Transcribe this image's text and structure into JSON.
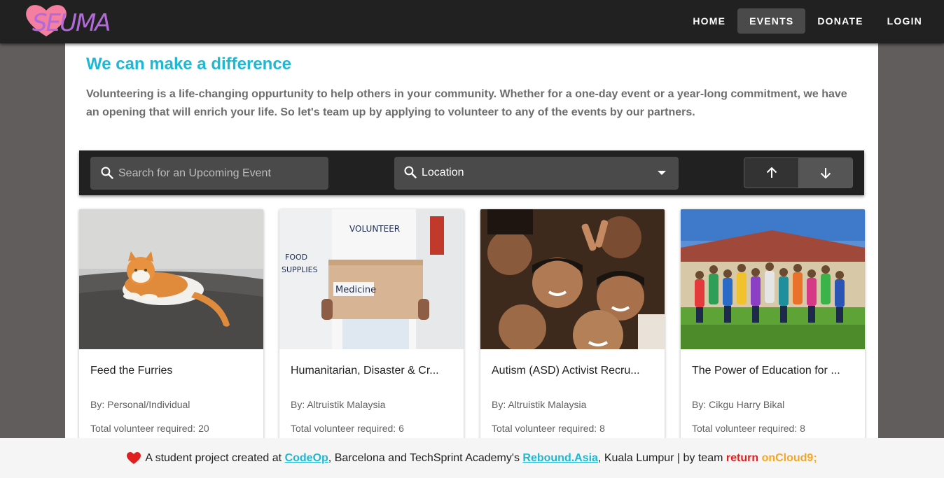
{
  "nav": {
    "logo_text": "SEUMA",
    "items": [
      {
        "label": "HOME",
        "active": false
      },
      {
        "label": "EVENTS",
        "active": true
      },
      {
        "label": "DONATE",
        "active": false
      },
      {
        "label": "LOGIN",
        "active": false
      }
    ]
  },
  "intro": {
    "title": "We can make a difference",
    "body": "Volunteering is a life-changing oppurtunity to help others in your community. Whether for a one-day event or a year-long commitment, we have an opening that will enrich your life. So let's team up by applying to volunteer to any of the events by our partners."
  },
  "filters": {
    "search_placeholder": "Search for an Upcoming Event",
    "search_value": "",
    "location_label": "Location",
    "sort_icons": [
      "arrow-up-icon",
      "arrow-down-icon"
    ],
    "active_sort": "descending"
  },
  "events": [
    {
      "title": "Feed the Furries",
      "by": "By: Personal/Individual",
      "required": "Total volunteer required: 20",
      "image": "orange-white-cat-photo"
    },
    {
      "title": "Humanitarian, Disaster & Cr...",
      "by": "By: Altruistik Malaysia",
      "required": "Total volunteer required: 6",
      "image": "volunteer-medicine-box-photo"
    },
    {
      "title": "Autism (ASD) Activist Recru...",
      "by": "By: Altruistik Malaysia",
      "required": "Total volunteer required: 8",
      "image": "smiling-children-photo"
    },
    {
      "title": "The Power of Education for ...",
      "by": "By: Cikgu Harry Bikal",
      "required": "Total volunteer required: 8",
      "image": "jumping-students-photo"
    }
  ],
  "footer": {
    "prefix": "A student project created at",
    "link1": "CodeOp",
    "middle": ", Barcelona and TechSprint Academy's",
    "link2": "Rebound.Asia",
    "suffix": ", Kuala Lumpur | by team",
    "kw": "return",
    "team": "onCloud9;"
  },
  "colors": {
    "accent": "#1fb8d3",
    "appbar": "#212121",
    "backdrop": "#615d5c",
    "heart": "#e02020",
    "logo_heart": "#f47fa0",
    "logo_text": "#b26ad8"
  }
}
